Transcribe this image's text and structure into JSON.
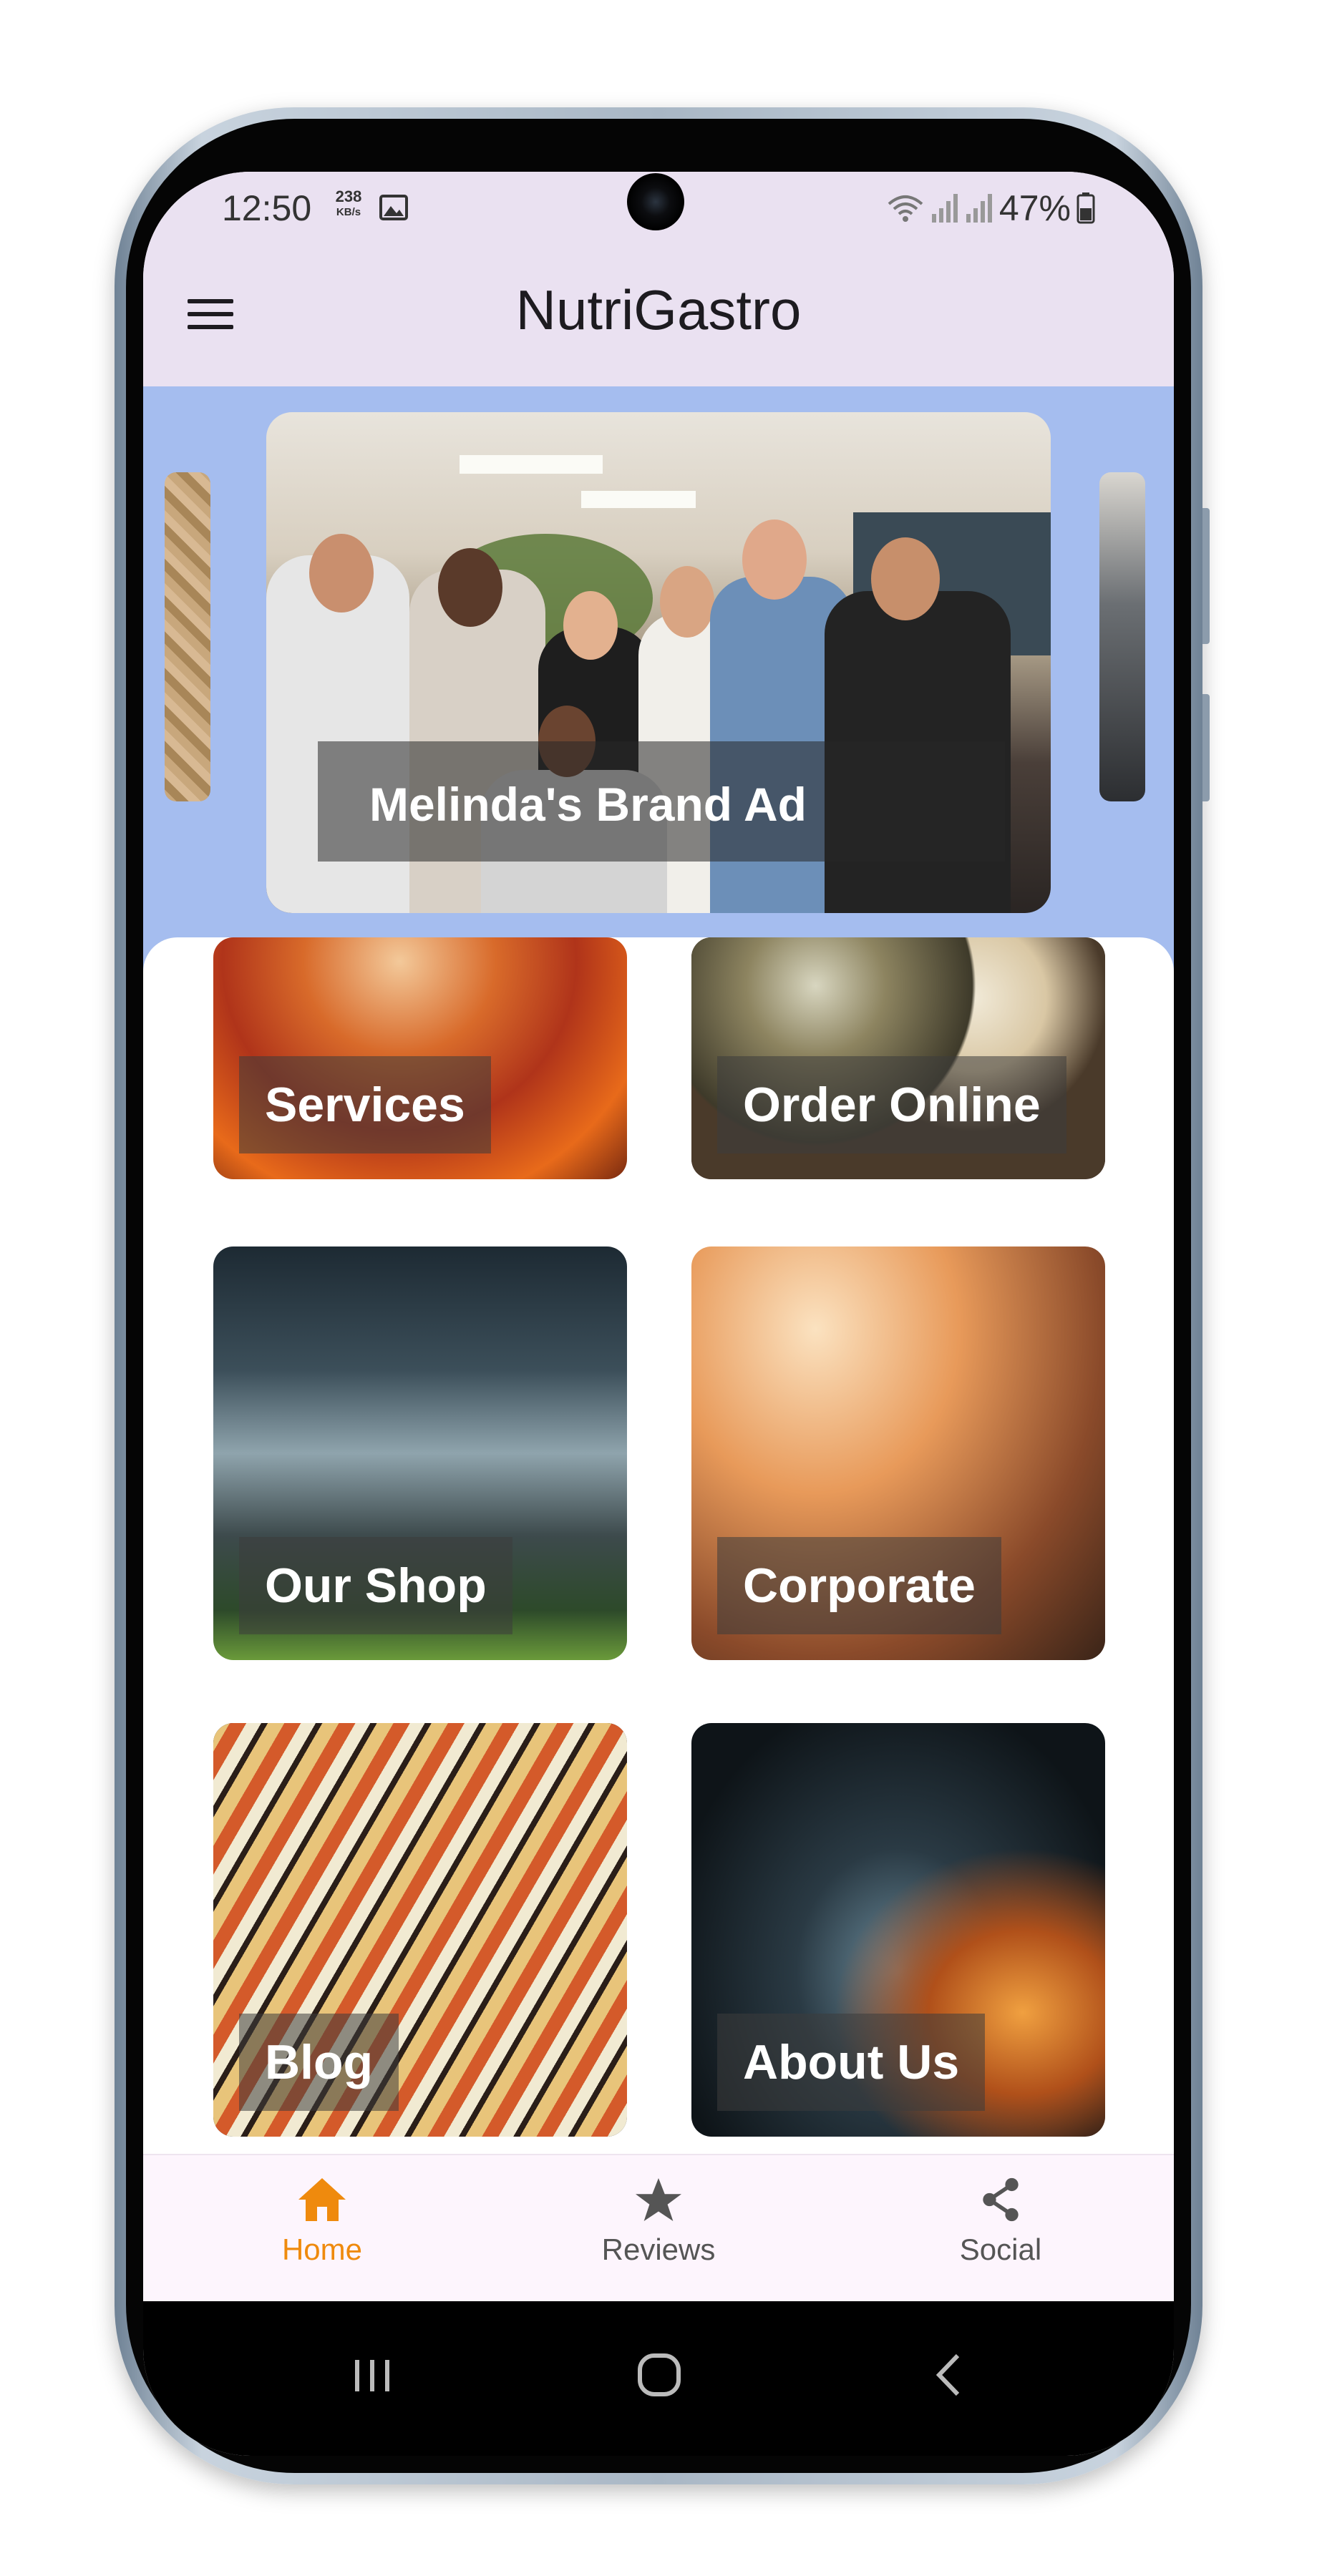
{
  "status_bar": {
    "time": "12:50",
    "speed": "238",
    "speed_unit": "KB/s",
    "battery": "47%",
    "icons": [
      "image-icon",
      "wifi-icon",
      "signal-icon",
      "signal-icon",
      "battery-icon"
    ]
  },
  "app_bar": {
    "title": "NutriGastro",
    "menu_icon": "hamburger-menu-icon"
  },
  "carousel": {
    "current_caption": "Melinda's Brand Ad"
  },
  "tiles": [
    {
      "label": "Services"
    },
    {
      "label": "Order Online"
    },
    {
      "label": "Our Shop"
    },
    {
      "label": "Corporate"
    },
    {
      "label": "Blog"
    },
    {
      "label": "About Us"
    }
  ],
  "bottom_nav": {
    "items": [
      {
        "label": "Home",
        "icon": "home-icon",
        "active": true
      },
      {
        "label": "Reviews",
        "icon": "star-icon",
        "active": false
      },
      {
        "label": "Social",
        "icon": "share-icon",
        "active": false
      }
    ],
    "active_color": "#ef8a0d",
    "inactive_color": "#555555"
  },
  "system_nav": {
    "icons": [
      "recent-apps-icon",
      "home-circle-icon",
      "back-icon"
    ]
  },
  "colors": {
    "app_bar": "#eae1f1",
    "carousel_bg": "#a5bdef",
    "nav_bg": "#fdf5fd"
  }
}
